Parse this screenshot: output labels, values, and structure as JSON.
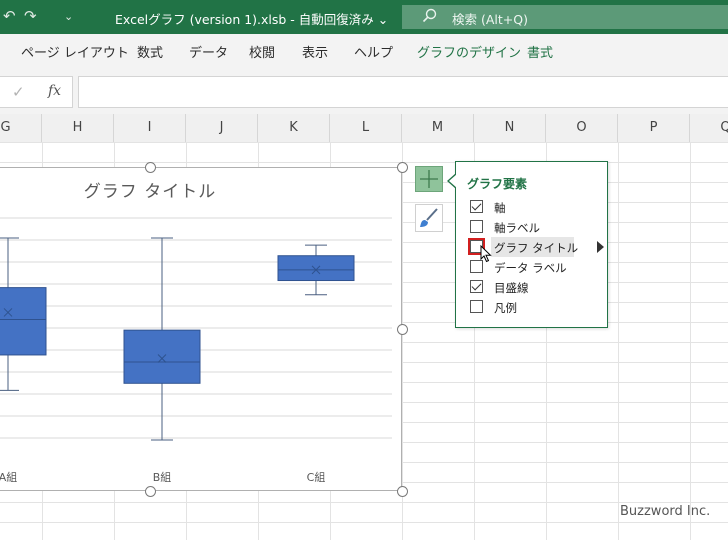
{
  "titlebar": {
    "title": "Excelグラフ (version 1).xlsb  -  自動回復済み  ⌄",
    "search_placeholder": "検索 (Alt+Q)"
  },
  "ribbon": {
    "tabs": [
      {
        "label": "ページ レイアウト",
        "contextual": false
      },
      {
        "label": "数式",
        "contextual": false
      },
      {
        "label": "データ",
        "contextual": false
      },
      {
        "label": "校閲",
        "contextual": false
      },
      {
        "label": "表示",
        "contextual": false
      },
      {
        "label": "ヘルプ",
        "contextual": false
      },
      {
        "label": "グラフのデザイン",
        "contextual": true
      },
      {
        "label": "書式",
        "contextual": true
      }
    ]
  },
  "formula_bar": {
    "fx": "fx",
    "value": ""
  },
  "columns": [
    "G",
    "H",
    "I",
    "J",
    "K",
    "L",
    "M",
    "N",
    "O",
    "P",
    "Q"
  ],
  "chart": {
    "title": "グラフ タイトル"
  },
  "chart_data": {
    "type": "box",
    "title": "グラフ タイトル",
    "categories": [
      "A組",
      "B組",
      "C組"
    ],
    "boxes": [
      {
        "category": "A組",
        "min": 52,
        "q1": 62,
        "median": 72,
        "q3": 81,
        "max": 95,
        "mean": 74
      },
      {
        "category": "B組",
        "min": 38,
        "q1": 54,
        "median": 60,
        "q3": 69,
        "max": 95,
        "mean": 61
      },
      {
        "category": "C組",
        "min": 79,
        "q1": 83,
        "median": 86,
        "q3": 90,
        "max": 93,
        "mean": 86
      }
    ],
    "grid": true,
    "color": "#4472c4"
  },
  "flyout": {
    "title": "グラフ要素",
    "items": [
      {
        "label": "軸",
        "checked": true
      },
      {
        "label": "軸ラベル",
        "checked": false
      },
      {
        "label": "グラフ タイトル",
        "checked": false
      },
      {
        "label": "データ ラベル",
        "checked": false
      },
      {
        "label": "目盛線",
        "checked": true
      },
      {
        "label": "凡例",
        "checked": false
      }
    ]
  },
  "watermark": "Buzzword Inc.",
  "colors": {
    "excel_green": "#217346",
    "box_fill": "#4472c4",
    "focus_red": "#d21f1f"
  }
}
